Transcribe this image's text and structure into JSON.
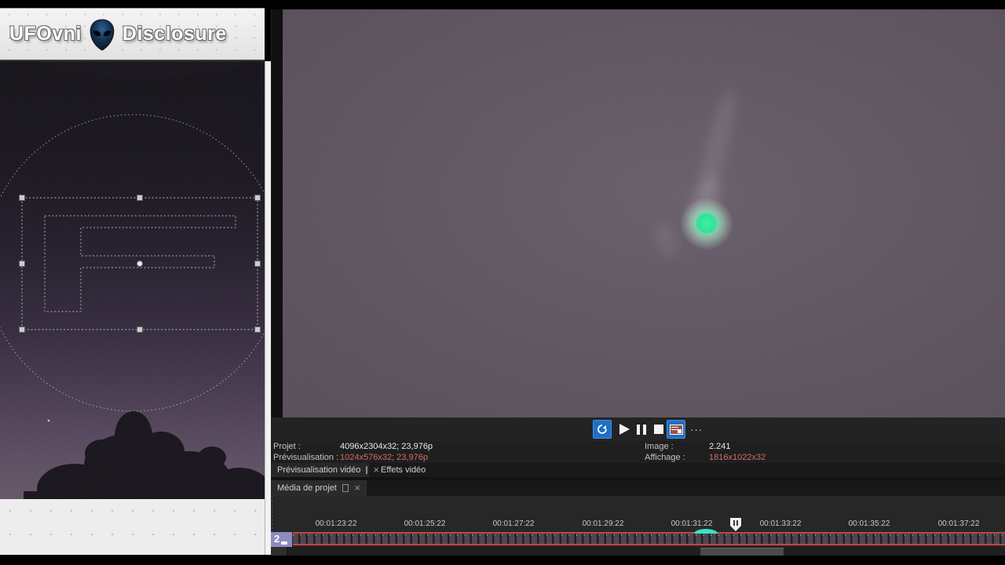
{
  "branding": {
    "word1": "UFOvni",
    "word2": "Disclosure",
    "icon": "alien-head-icon"
  },
  "info": {
    "rows_left": [
      {
        "label": "Projet :",
        "value": "4096x2304x32; 23,976p",
        "highlight": false
      },
      {
        "label": "Prévisualisation :",
        "value": "1024x576x32; 23,976p",
        "highlight": true
      }
    ],
    "rows_right": [
      {
        "label": "Image :",
        "value": "2.241",
        "highlight": false
      },
      {
        "label": "Affichage :",
        "value": "1816x1022x32",
        "highlight": true
      }
    ]
  },
  "tabs": {
    "preview_tab": "Prévisualisation vidéo",
    "effects_tab": "Effets vidéo",
    "media_tab": "Média de projet"
  },
  "transport": {
    "buttons": [
      "loop-playback",
      "play",
      "pause",
      "stop",
      "copy-frame",
      "more-options"
    ],
    "loop_active": true,
    "copy_frame_active": true,
    "more_label": "···"
  },
  "timeline": {
    "track_number": "2",
    "timecodes": [
      "00:01:23:22",
      "00:01:25:22",
      "00:01:27:22",
      "00:01:29:22",
      "00:01:31:22",
      "00:01:33:22",
      "00:01:35:22",
      "00:01:37:22"
    ],
    "marker": "pause-marker-flag",
    "playhead": "cyan-playhead"
  },
  "icons": {
    "close": "×"
  },
  "colors": {
    "highlight_value_red": "#d16b6b",
    "ruler_border_red": "#bf4747",
    "playhead_cyan": "#3ce3c3",
    "orb_green": "#2ee398",
    "track_badge_purple": "#8f8bbe",
    "transport_active_blue": "#1f6fc4",
    "video_bg_purple": "#5e5461"
  }
}
